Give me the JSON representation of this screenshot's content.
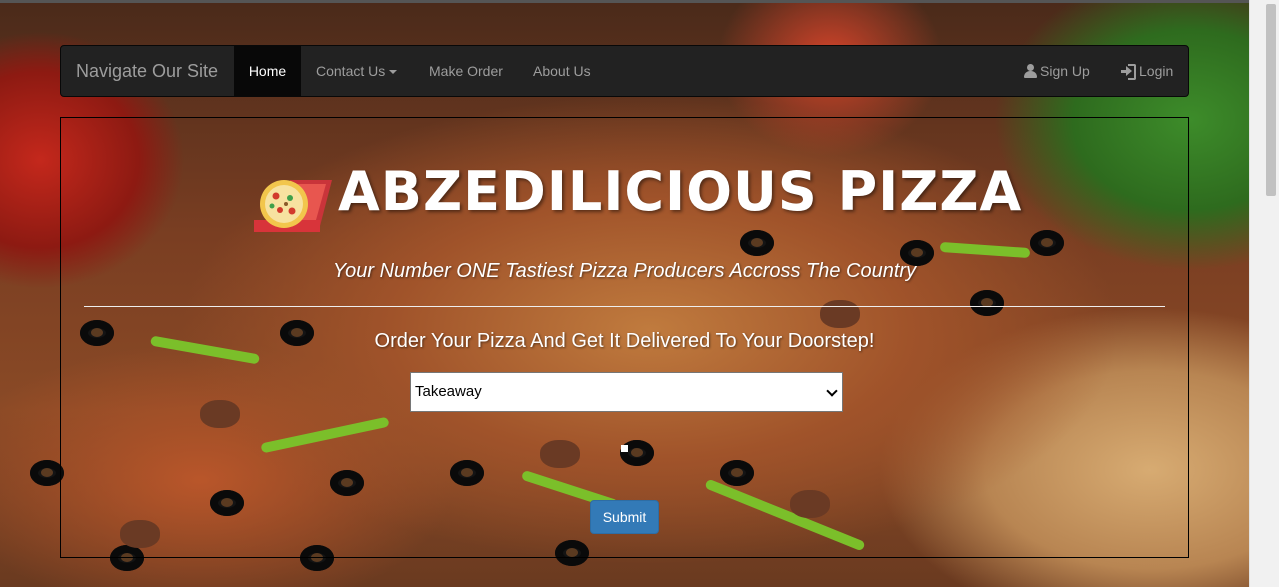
{
  "navbar": {
    "brand": "Navigate Our Site",
    "items": [
      {
        "label": "Home",
        "active": true
      },
      {
        "label": "Contact Us",
        "dropdown": true
      },
      {
        "label": "Make Order"
      },
      {
        "label": "About Us"
      }
    ],
    "right": [
      {
        "label": "Sign Up",
        "icon": "user-icon"
      },
      {
        "label": "Login",
        "icon": "login-icon"
      }
    ]
  },
  "hero": {
    "title": "ABZEDILICIOUS PIZZA",
    "tagline": "Your Number ONE Tastiest Pizza Producers Accross The Country",
    "order_heading": "Order Your Pizza And Get It Delivered To Your Doorstep!"
  },
  "order_form": {
    "delivery_select": {
      "selected": "Takeaway"
    },
    "submit_label": "Submit"
  },
  "colors": {
    "navbar_bg": "#222222",
    "navbar_active": "#080808",
    "button_primary": "#337ab7",
    "text_light": "#ffffff",
    "nav_text": "#9d9d9d"
  },
  "icons": [
    "pizza-box-icon",
    "user-icon",
    "login-icon",
    "caret-down-icon",
    "chevron-down-icon"
  ]
}
